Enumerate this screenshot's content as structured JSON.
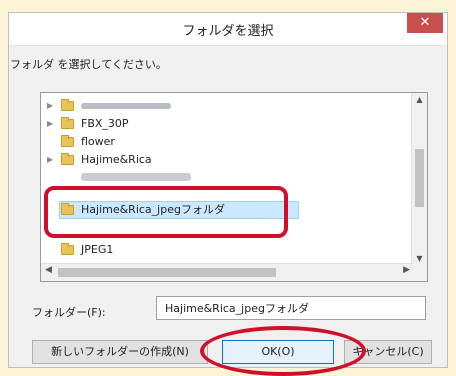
{
  "dialog": {
    "title": "フォルダを選択",
    "close_label": "✕",
    "instruction": "フォルダ を選択してください。"
  },
  "tree": {
    "items": [
      {
        "label": "FBX_30P",
        "expandable": true
      },
      {
        "label": "flower",
        "expandable": false
      },
      {
        "label": "Hajime&Rica",
        "expandable": true
      },
      {
        "label": "Hajime&Rica_jpegフォルダ",
        "expandable": false,
        "selected": true
      },
      {
        "label": "JPEG1",
        "expandable": false
      }
    ]
  },
  "folder_field": {
    "label": "フォルダー(F):",
    "value": "Hajime&Rica_jpegフォルダ"
  },
  "buttons": {
    "new_folder": "新しいフォルダーの作成(N)",
    "ok": "OK(O)",
    "cancel": "キャンセル(C)"
  },
  "colors": {
    "highlight_red": "#d0102b",
    "selection": "#cce8ff",
    "close_red": "#c7504f",
    "background": "#fdf3d6"
  },
  "icons": {
    "folder": "folder-icon",
    "expand": "chevron-right-icon",
    "close": "close-icon"
  }
}
